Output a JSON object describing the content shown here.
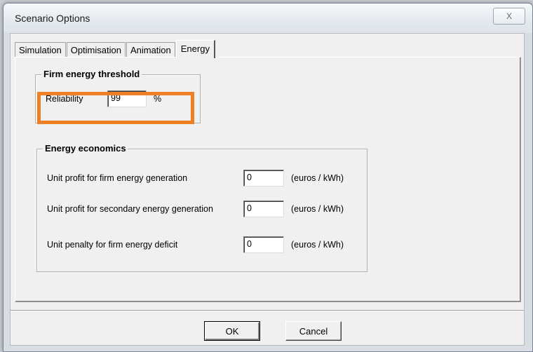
{
  "window": {
    "title": "Scenario Options",
    "close_glyph": "X"
  },
  "tabs": [
    {
      "label": "Simulation"
    },
    {
      "label": "Optimisation"
    },
    {
      "label": "Animation"
    },
    {
      "label": "Energy",
      "active": true
    }
  ],
  "firm_energy_threshold": {
    "title": "Firm energy threshold",
    "reliability_label": "Reliability",
    "reliability_value": "99",
    "reliability_unit": "%"
  },
  "energy_economics": {
    "title": "Energy economics",
    "rows": [
      {
        "label": "Unit profit for firm energy generation",
        "value": "0",
        "unit": "(euros / kWh)"
      },
      {
        "label": "Unit profit for secondary energy generation",
        "value": "0",
        "unit": "(euros / kWh)"
      },
      {
        "label": "Unit penalty for firm energy deficit",
        "value": "0",
        "unit": "(euros / kWh)"
      }
    ]
  },
  "buttons": {
    "ok": "OK",
    "cancel": "Cancel"
  },
  "colors": {
    "highlight": "#ef7f24"
  }
}
